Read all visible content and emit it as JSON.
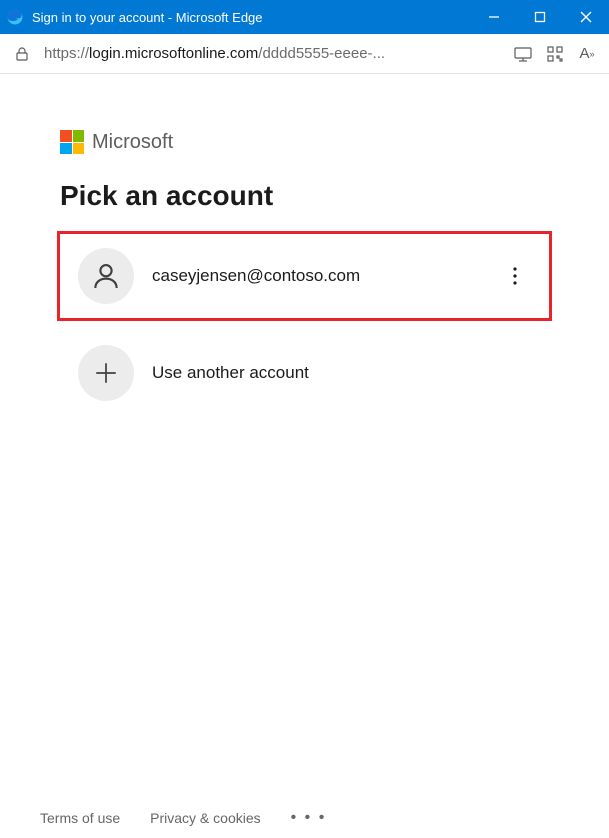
{
  "window": {
    "title": "Sign in to your account - Microsoft Edge"
  },
  "addressbar": {
    "scheme": "https://",
    "host": "login.microsoftonline.com",
    "path": "/dddd5555-eeee-..."
  },
  "brand": {
    "name": "Microsoft"
  },
  "page": {
    "heading": "Pick an account"
  },
  "accounts": [
    {
      "email": "caseyjensen@contoso.com"
    }
  ],
  "use_another": {
    "label": "Use another account"
  },
  "footer": {
    "terms": "Terms of use",
    "privacy": "Privacy & cookies",
    "more": "• • •"
  }
}
